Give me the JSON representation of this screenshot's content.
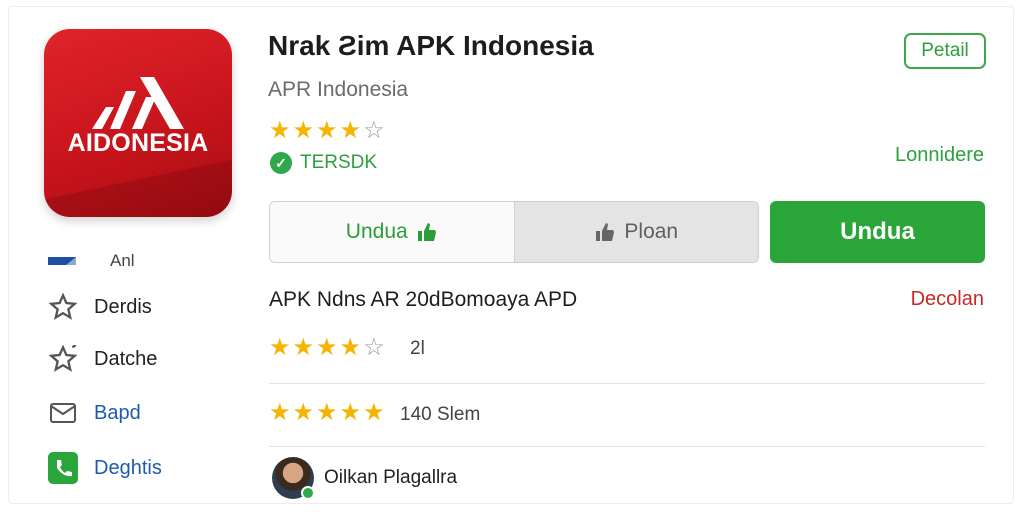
{
  "app": {
    "name": "Nrak Ƨim APK Indonesia",
    "publisher": "APR Indonesia",
    "icon_text": "AIDONESIA",
    "rating_stars": 4,
    "verified_label": "TERSDK",
    "detail_button": "Petail",
    "secondary_link": "Lonnidere"
  },
  "actions": {
    "download_outline": "Undua",
    "preview": "Ploan",
    "download_primary": "Undua"
  },
  "sidebar": {
    "items": [
      {
        "label": "Anl",
        "icon": "flag-icon"
      },
      {
        "label": "Derdis",
        "icon": "star-outline-icon"
      },
      {
        "label": "Datche",
        "icon": "star-sparkle-icon"
      },
      {
        "label": "Bapd",
        "icon": "mail-icon"
      },
      {
        "label": "Deghtis",
        "icon": "phone-icon"
      }
    ]
  },
  "details": {
    "title": "APK Ndns AR 20dBomoaya APD",
    "right_link": "Decolan",
    "rating_row_1": {
      "stars": 4,
      "count": "2l"
    },
    "rating_row_2": {
      "stars": 5,
      "count": "140 Slem"
    }
  },
  "reviewer": {
    "name": "Oilkan Plagallra"
  },
  "colors": {
    "brand_red": "#d01a20",
    "accent_green": "#2aa53a",
    "star": "#f4b400",
    "danger": "#c62828"
  }
}
